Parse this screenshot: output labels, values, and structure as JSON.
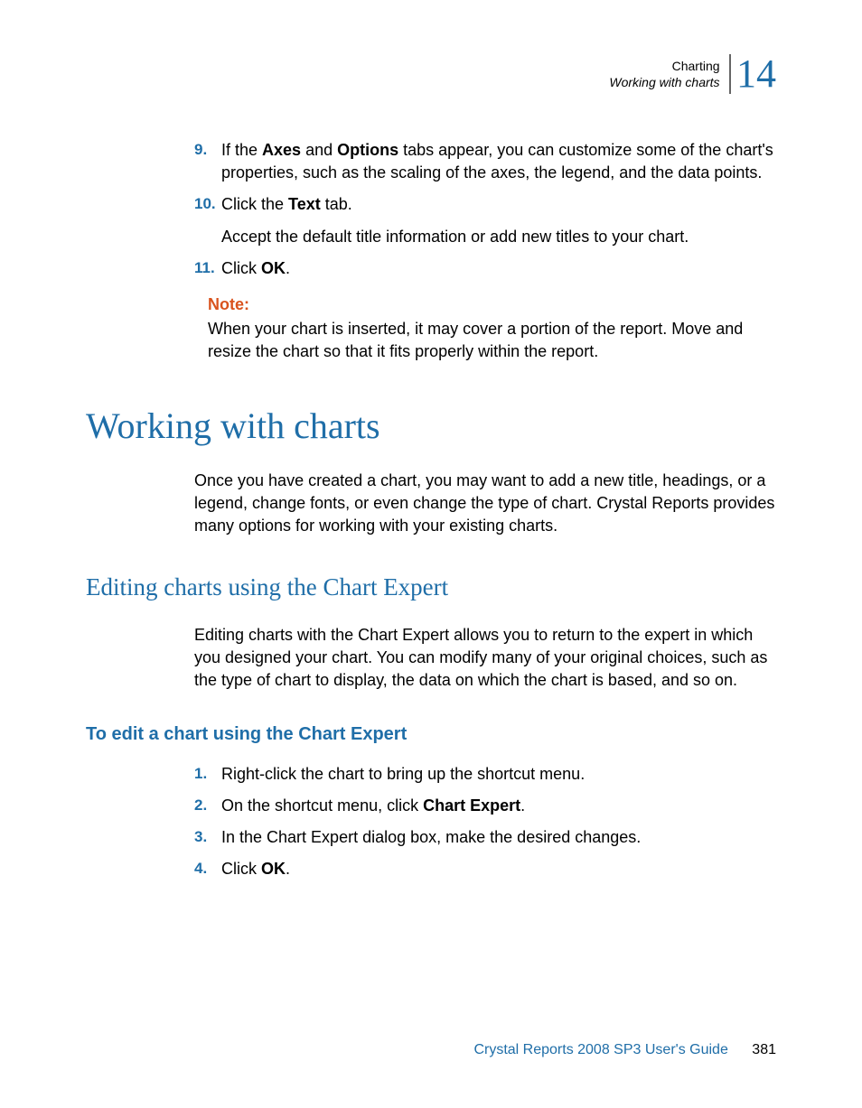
{
  "header": {
    "chapter": "Charting",
    "section": "Working with charts",
    "chapter_number": "14"
  },
  "steps_top": {
    "s9": {
      "num": "9.",
      "pre": "If the ",
      "b1": "Axes",
      "mid": " and ",
      "b2": "Options",
      "post": " tabs appear, you can customize some of the chart's properties, such as the scaling of the axes, the legend, and the data points."
    },
    "s10": {
      "num": "10.",
      "pre": "Click the ",
      "b1": "Text",
      "post": " tab.",
      "sub": "Accept the default title information or add new titles to your chart."
    },
    "s11": {
      "num": "11.",
      "pre": "Click ",
      "b1": "OK",
      "post": "."
    }
  },
  "note": {
    "label": "Note:",
    "text": "When your chart is inserted, it may cover a portion of the report. Move and resize the chart so that it fits properly within the report."
  },
  "h1": "Working with charts",
  "intro": "Once you have created a chart, you may want to add a new title, headings, or a legend, change fonts, or even change the type of chart. Crystal Reports provides many options for working with your existing charts.",
  "h2": "Editing charts using the Chart Expert",
  "edit_intro": "Editing charts with the Chart Expert allows you to return to the expert in which you designed your chart. You can modify many of your original choices, such as the type of chart to display, the data on which the chart is based, and so on.",
  "h3": "To edit a chart using the Chart Expert",
  "steps_edit": {
    "s1": {
      "num": "1.",
      "text": "Right-click the chart to bring up the shortcut menu."
    },
    "s2": {
      "num": "2.",
      "pre": "On the shortcut menu, click ",
      "b1": "Chart Expert",
      "post": "."
    },
    "s3": {
      "num": "3.",
      "text": "In the Chart Expert dialog box, make the desired changes."
    },
    "s4": {
      "num": "4.",
      "pre": "Click ",
      "b1": "OK",
      "post": "."
    }
  },
  "footer": {
    "guide": "Crystal Reports 2008 SP3 User's Guide",
    "page": "381"
  }
}
